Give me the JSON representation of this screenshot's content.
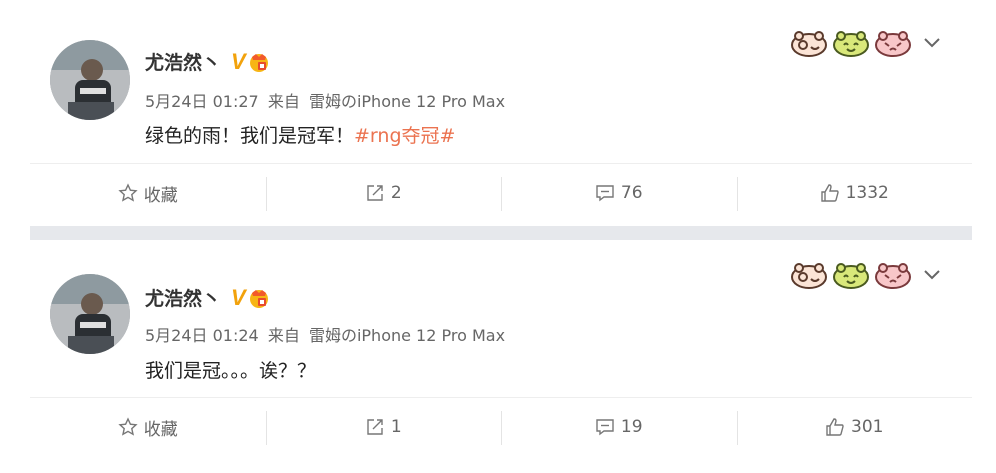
{
  "posts": [
    {
      "username": "尤浩然丶",
      "verified_mark": "V",
      "date": "5月24日 01:27",
      "source_prefix": "来自",
      "source": "雷姆のiPhone 12 Pro Max",
      "text": "绿色的雨！我们是冠军！",
      "hashtag": "#rng夺冠#",
      "actions": {
        "favorite": "收藏",
        "repost": "2",
        "comment": "76",
        "like": "1332"
      }
    },
    {
      "username": "尤浩然丶",
      "verified_mark": "V",
      "date": "5月24日 01:24",
      "source_prefix": "来自",
      "source": "雷姆のiPhone 12 Pro Max",
      "text": "我们是冠。。。诶？？",
      "hashtag": "",
      "actions": {
        "favorite": "收藏",
        "repost": "1",
        "comment": "19",
        "like": "301"
      }
    }
  ],
  "icons": {
    "favorite": "star-outline-icon",
    "repost": "repost-icon",
    "comment": "comment-icon",
    "like": "thumbs-up-icon",
    "more": "chevron-down-icon"
  },
  "colors": {
    "hashtag": "#eb7350",
    "verified": "#f2a20c",
    "separator": "#e6e8ec"
  }
}
